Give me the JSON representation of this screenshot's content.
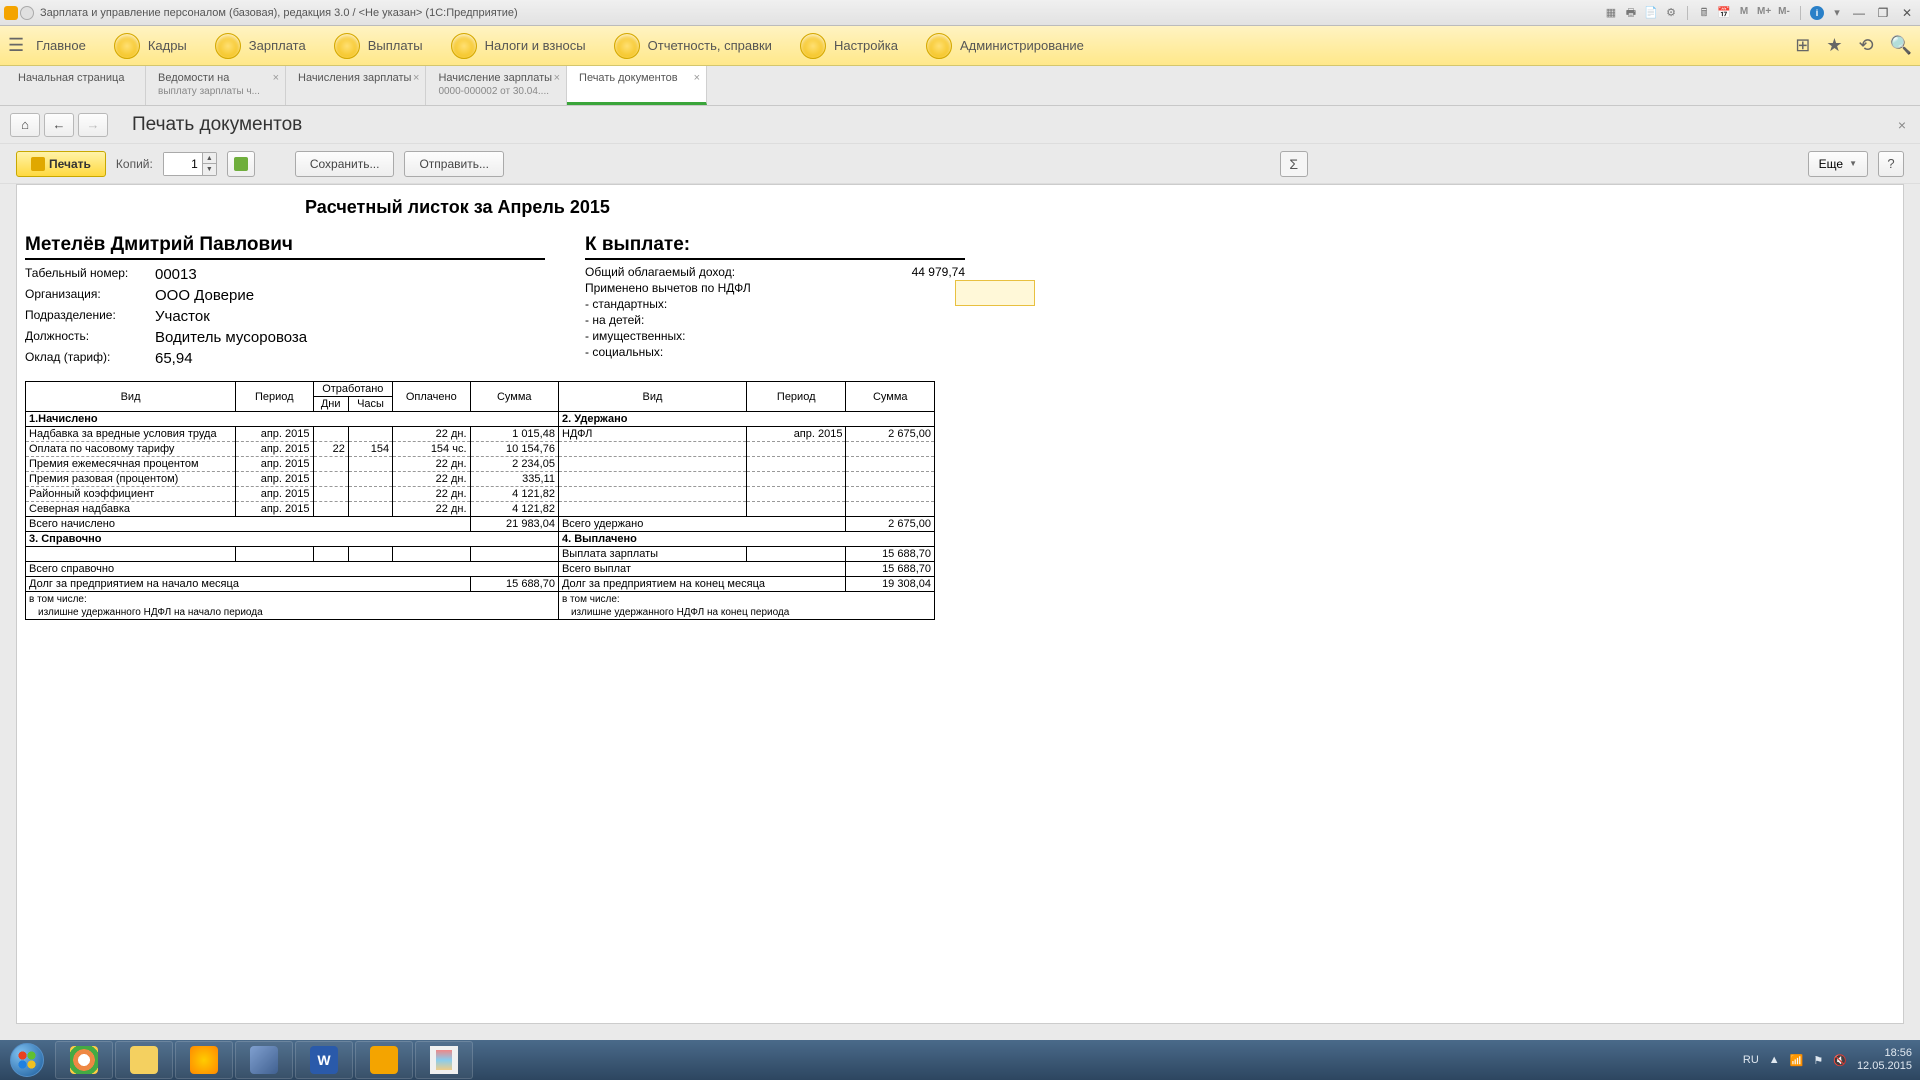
{
  "window": {
    "title": "Зарплата и управление персоналом (базовая), редакция 3.0 / <Не указан>  (1С:Предприятие)"
  },
  "titlebar_icons": {
    "m": "M",
    "mplus": "M+",
    "mminus": "M-"
  },
  "menu": {
    "items": [
      "Главное",
      "Кадры",
      "Зарплата",
      "Выплаты",
      "Налоги и взносы",
      "Отчетность, справки",
      "Настройка",
      "Администрирование"
    ]
  },
  "tabs": [
    {
      "line1": "Начальная страница",
      "line2": "",
      "closable": false
    },
    {
      "line1": "Ведомости на",
      "line2": "выплату зарплаты ч...",
      "closable": true
    },
    {
      "line1": "Начисления зарплаты",
      "line2": "",
      "closable": true
    },
    {
      "line1": "Начисление зарплаты",
      "line2": "0000-000002 от 30.04....",
      "closable": true
    },
    {
      "line1": "Печать документов",
      "line2": "",
      "closable": true,
      "active": true
    }
  ],
  "page": {
    "title": "Печать документов"
  },
  "toolbar": {
    "print": "Печать",
    "copies_label": "Копий:",
    "copies_value": "1",
    "save": "Сохранить...",
    "send": "Отправить...",
    "more": "Еще",
    "help": "?"
  },
  "doc": {
    "title": "Расчетный листок за Апрель 2015",
    "employee": "Метелёв Дмитрий Павлович",
    "info": {
      "tabno_lbl": "Табельный номер:",
      "tabno": "00013",
      "org_lbl": "Организация:",
      "org": "ООО Доверие",
      "dept_lbl": "Подразделение:",
      "dept": "Участок",
      "pos_lbl": "Должность:",
      "pos": "Водитель мусоровоза",
      "rate_lbl": "Оклад (тариф):",
      "rate": "65,94"
    },
    "payout": {
      "head": "К выплате:",
      "tax_income_lbl": "Общий облагаемый доход:",
      "tax_income": "44 979,74",
      "deduct_head": "Применено вычетов по НДФЛ",
      "d1": "- стандартных:",
      "d2": "- на детей:",
      "d3": "- имущественных:",
      "d4": "- социальных:"
    },
    "table": {
      "h_vid": "Вид",
      "h_period": "Период",
      "h_worked": "Отработано",
      "h_days": "Дни",
      "h_hours": "Часы",
      "h_paid": "Оплачено",
      "h_sum": "Сумма",
      "s1": "1.Начислено",
      "s2": "2. Удержано",
      "s3": "3. Справочно",
      "s4": "4. Выплачено",
      "accr_rows": [
        {
          "vid": "Надбавка за вредные условия труда",
          "per": "апр. 2015",
          "d": "",
          "h": "",
          "paid": "22 дн.",
          "sum": "1 015,48"
        },
        {
          "vid": "Оплата по часовому тарифу",
          "per": "апр. 2015",
          "d": "22",
          "h": "154",
          "paid": "154 чс.",
          "sum": "10 154,76"
        },
        {
          "vid": "Премия ежемесячная процентом",
          "per": "апр. 2015",
          "d": "",
          "h": "",
          "paid": "22 дн.",
          "sum": "2 234,05"
        },
        {
          "vid": "Премия разовая (процентом)",
          "per": "апр. 2015",
          "d": "",
          "h": "",
          "paid": "22 дн.",
          "sum": "335,11"
        },
        {
          "vid": "Районный коэффициент",
          "per": "апр. 2015",
          "d": "",
          "h": "",
          "paid": "22 дн.",
          "sum": "4 121,82"
        },
        {
          "vid": "Северная надбавка",
          "per": "апр. 2015",
          "d": "",
          "h": "",
          "paid": "22 дн.",
          "sum": "4 121,82"
        }
      ],
      "ded_rows": [
        {
          "vid": "НДФЛ",
          "per": "апр. 2015",
          "sum": "2 675,00"
        }
      ],
      "accr_total_lbl": "Всего начислено",
      "accr_total": "21 983,04",
      "ded_total_lbl": "Всего удержано",
      "ded_total": "2 675,00",
      "ref_total_lbl": "Всего справочно",
      "paid_rows": [
        {
          "vid": "Выплата зарплаты",
          "sum": "15 688,70"
        }
      ],
      "paid_total_lbl": "Всего выплат",
      "paid_total": "15 688,70",
      "debt_start_lbl": "Долг за предприятием на начало месяца",
      "debt_start": "15 688,70",
      "debt_end_lbl": "Долг за предприятием на конец месяца",
      "debt_end": "19 308,04",
      "incl": "в том числе:",
      "excess_start": "излишне удержанного НДФЛ на начало периода",
      "excess_end": "излишне удержанного НДФЛ на конец периода"
    }
  },
  "tray": {
    "lang": "RU",
    "time": "18:56",
    "date": "12.05.2015"
  }
}
